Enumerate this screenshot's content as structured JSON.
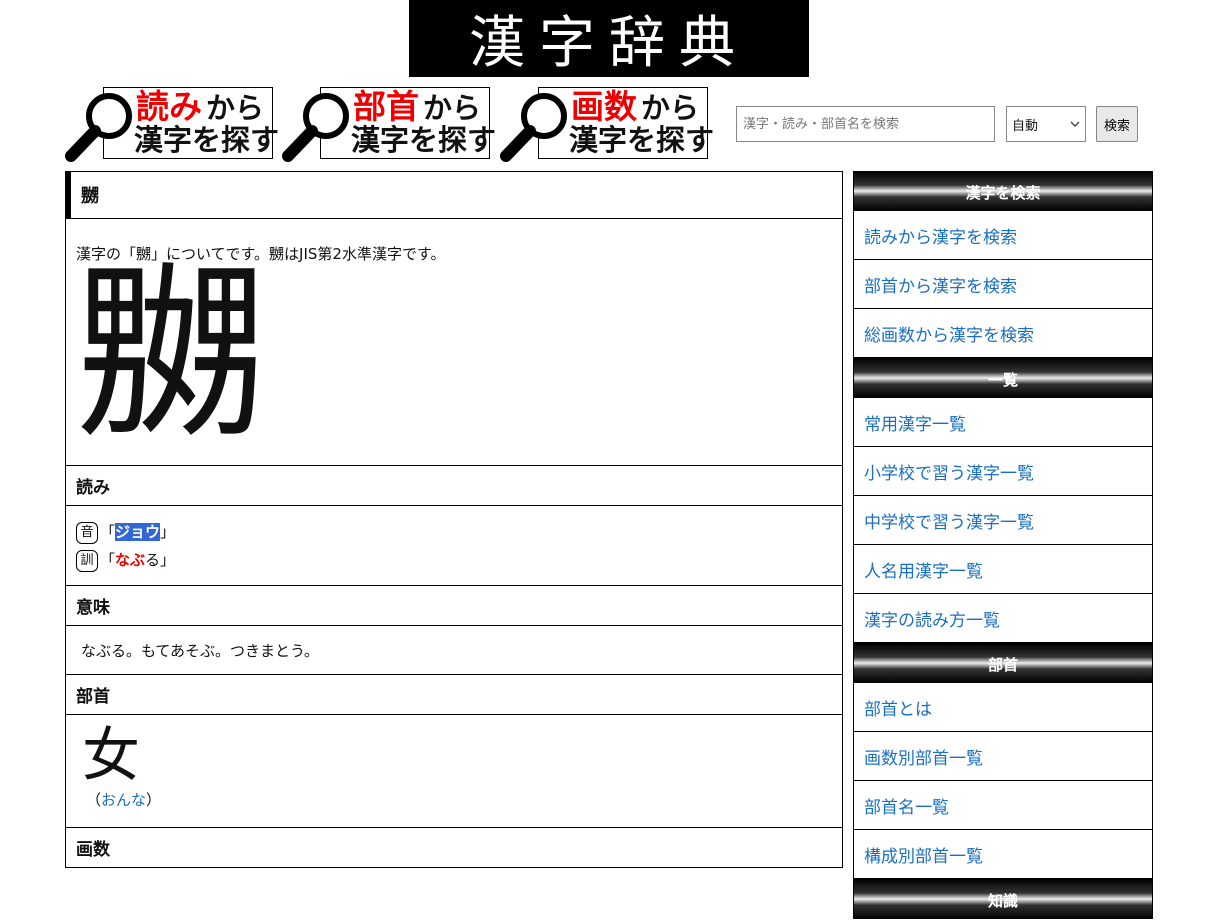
{
  "site": {
    "logo": "漢字辞典"
  },
  "search_buttons": [
    {
      "highlight": "読み",
      "suffix": "から",
      "line2": "漢字を探す"
    },
    {
      "highlight": "部首",
      "suffix": "から",
      "line2": "漢字を探す"
    },
    {
      "highlight": "画数",
      "suffix": "から",
      "line2": "漢字を探す"
    }
  ],
  "search": {
    "placeholder": "漢字・読み・部首名を検索",
    "mode": "自動",
    "button": "検索"
  },
  "kanji": {
    "title": "嬲",
    "intro": "漢字の「嬲」についてです。嬲はJIS第2水準漢字です。",
    "big": "嬲"
  },
  "sections": {
    "readings": "読み",
    "meaning": "意味",
    "bushu": "部首",
    "strokes": "画数"
  },
  "readings": {
    "on_mark": "音",
    "on_open": "「",
    "on_value": "ジョウ",
    "on_close": "」",
    "kun_mark": "訓",
    "kun_open": "「",
    "kun_value": "なぶ",
    "kun_okuri": "る",
    "kun_close": "」"
  },
  "meaning": "なぶる。もてあそぶ。つきまとう。",
  "bushu": {
    "char": "女",
    "open": "（",
    "reading": "おんな",
    "close": "）"
  },
  "sidebar": {
    "groups": [
      {
        "title": "漢字を検索",
        "items": [
          "読みから漢字を検索",
          "部首から漢字を検索",
          "総画数から漢字を検索"
        ]
      },
      {
        "title": "一覧",
        "items": [
          "常用漢字一覧",
          "小学校で習う漢字一覧",
          "中学校で習う漢字一覧",
          "人名用漢字一覧",
          "漢字の読み方一覧"
        ]
      },
      {
        "title": "部首",
        "items": [
          "部首とは",
          "画数別部首一覧",
          "部首名一覧",
          "構成別部首一覧"
        ]
      },
      {
        "title": "知識",
        "items": []
      }
    ]
  }
}
